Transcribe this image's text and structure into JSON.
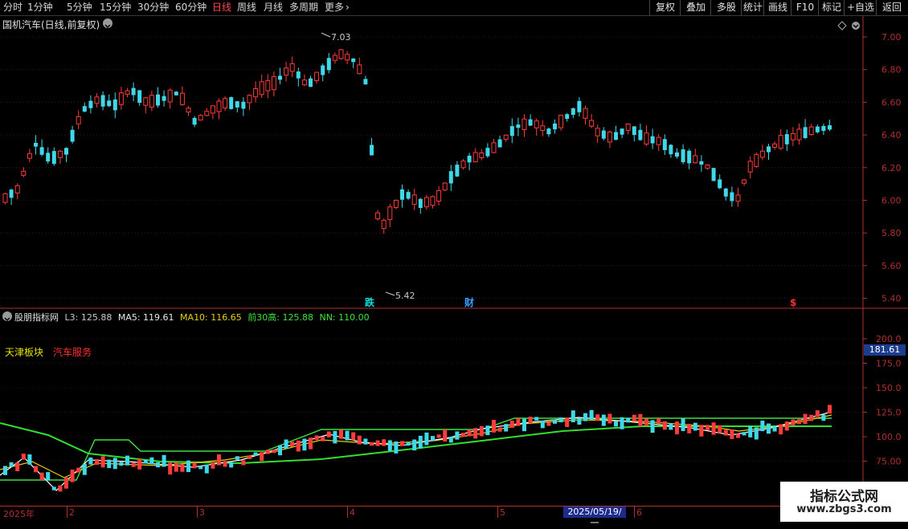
{
  "toolbar": {
    "periods": [
      "分时",
      "1分钟",
      "5分钟",
      "15分钟",
      "30分钟",
      "60分钟",
      "日线",
      "周线",
      "月线",
      "多周期",
      "更多"
    ],
    "active_period": "日线",
    "buttons": [
      "复权",
      "叠加",
      "多股",
      "统计",
      "画线",
      "F10",
      "+自选",
      "返回"
    ],
    "mark_label": "标记"
  },
  "main_panel": {
    "title": "国机汽车(日线,前复权)",
    "high_label": "7.03",
    "low_label": "5.42",
    "events": [
      {
        "text": "跌",
        "color": "#00e0e0"
      },
      {
        "text": "财",
        "color": "#33a0ff"
      },
      {
        "text": "$",
        "color": "#ff3030"
      }
    ],
    "price_axis": [
      "7.00",
      "6.80",
      "6.60",
      "6.40",
      "6.20",
      "6.00",
      "5.80",
      "5.60",
      "5.40"
    ]
  },
  "indicator_panel": {
    "name": "股朋指标网",
    "values": [
      {
        "label": "L3: 125.88",
        "color": "#c8c8c8"
      },
      {
        "label": "MA5: 119.61",
        "color": "#e8e8e8"
      },
      {
        "label": "MA10: 116.65",
        "color": "#e8d000"
      },
      {
        "label": "前30高: 125.88",
        "color": "#40e040"
      },
      {
        "label": "NN: 110.00",
        "color": "#40e040"
      }
    ],
    "tag_region": "天津板块",
    "tag_sector": "汽车服务",
    "current_value": "181.61",
    "axis": [
      "200.0",
      "175.0",
      "150.0",
      "125.0",
      "100.0",
      "75.00"
    ]
  },
  "date_axis": {
    "labels": [
      "2025年",
      "2",
      "3",
      "4",
      "5",
      "6"
    ],
    "cursor_date": "2025/05/19/一"
  },
  "watermark": {
    "title": "指标公式网",
    "url": "www.zbgs3.com"
  },
  "colors": {
    "up": "#ff3b3b",
    "down": "#3fd8e8",
    "ma5": "#ffffff",
    "ma10": "#e8d000",
    "high30": "#40e040",
    "nn": "#30e030",
    "grid": "#b03030"
  }
}
